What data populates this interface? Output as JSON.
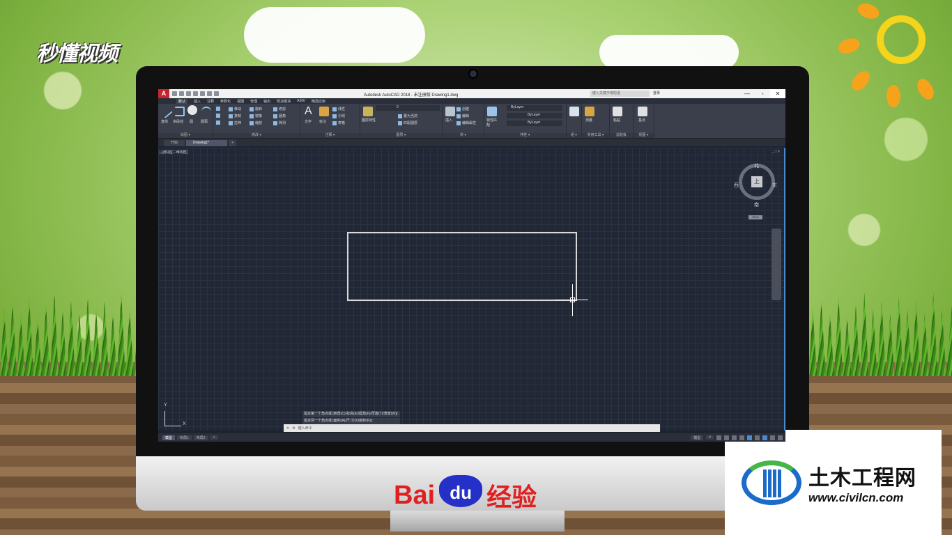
{
  "branding": {
    "top_left_logo": "秒懂视频",
    "baidu_bai": "Bai",
    "baidu_du": "du",
    "baidu_suffix": "经验",
    "civil_name": "土木工程网",
    "civil_url": "www.civilcn.com"
  },
  "app": {
    "icon_letter": "A",
    "title": "Autodesk AutoCAD 2018 - 未注册版    Drawing1.dwg",
    "search_placeholder": "键入关键字或短语",
    "user": "登录",
    "ribbon_tabs": [
      "默认",
      "插入",
      "注释",
      "参数化",
      "视图",
      "管理",
      "输出",
      "附加模块",
      "A360",
      "精选应用"
    ],
    "active_tab": "默认"
  },
  "ribbon": {
    "draw": {
      "label": "绘图 ▾",
      "line": "直线",
      "polyline": "多段线",
      "circle": "圆",
      "arc": "圆弧"
    },
    "modify": {
      "label": "修改 ▾",
      "move": "移动",
      "rotate": "旋转",
      "trim": "修剪",
      "copy": "复制",
      "mirror": "镜像",
      "fillet": "圆角",
      "stretch": "拉伸",
      "scale": "缩放",
      "array": "阵列"
    },
    "annotation": {
      "label": "注释 ▾",
      "text": "文字",
      "dimension": "标注",
      "linear": "线性",
      "leader": "引线",
      "table": "表格"
    },
    "layers": {
      "label": "图层 ▾",
      "layer_props": "图层特性",
      "layer_value": "0",
      "make_current": "置为当前",
      "match_layer": "匹配图层"
    },
    "block": {
      "label": "块 ▾",
      "insert": "插入",
      "create": "创建",
      "edit": "编辑",
      "edit_attr": "编辑属性"
    },
    "properties": {
      "label": "特性 ▾",
      "match": "特性匹配",
      "color": "ByLayer",
      "linetype": "ByLayer",
      "lineweight": "ByLayer"
    },
    "groups": {
      "label": "组 ▾"
    },
    "utilities": {
      "label": "实用工具 ▾",
      "measure": "测量"
    },
    "clipboard": {
      "label": "剪贴板",
      "paste": "粘贴"
    },
    "view": {
      "label": "视图 ▾",
      "base": "基点"
    }
  },
  "file_tabs": [
    {
      "label": "开始"
    },
    {
      "label": "Drawing1*"
    }
  ],
  "viewport": {
    "label": "[-][俯视][二维线框]",
    "controls": "_ □ ×",
    "viewcube": {
      "top": "上",
      "north": "北",
      "south": "南",
      "east": "东",
      "west": "西",
      "wcs": "WCS"
    },
    "ucs_x": "X",
    "ucs_y": "Y"
  },
  "command": {
    "history": [
      "指定第一个角点或 [倒角(C)/标高(E)/圆角(F)/厚度(T)/宽度(W)]:",
      "指定另一个角点或 [面积(A)/尺寸(D)/旋转(R)]:"
    ],
    "prompt": "键入命令"
  },
  "layout_tabs": [
    "模型",
    "布局1",
    "布局2"
  ],
  "status": {
    "mode": "模型",
    "grid": "#"
  }
}
